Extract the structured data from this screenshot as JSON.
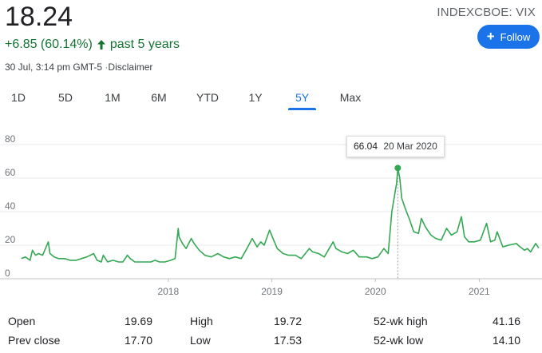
{
  "quote": {
    "price": "18.24",
    "ticker": "INDEXCBOE: VIX",
    "change": "+6.85 (60.14%)",
    "period": "past 5 years",
    "timestamp": "30 Jul, 3:14 pm GMT-5",
    "separator": "·",
    "disclaimer": "Disclaimer",
    "change_color": "#137333"
  },
  "follow_button": {
    "label": "Follow",
    "icon": "plus-icon"
  },
  "tabs": [
    {
      "label": "1D"
    },
    {
      "label": "5D"
    },
    {
      "label": "1M"
    },
    {
      "label": "6M"
    },
    {
      "label": "YTD"
    },
    {
      "label": "1Y"
    },
    {
      "label": "5Y",
      "active": true
    },
    {
      "label": "Max"
    }
  ],
  "tooltip": {
    "value": "66.04",
    "date": "20 Mar 2020"
  },
  "stats": [
    {
      "label": "Open",
      "value": "19.69"
    },
    {
      "label": "High",
      "value": "19.72"
    },
    {
      "label": "52-wk high",
      "value": "41.16"
    },
    {
      "label": "Prev close",
      "value": "17.70"
    },
    {
      "label": "Low",
      "value": "17.53"
    },
    {
      "label": "52-wk low",
      "value": "14.10"
    }
  ],
  "chart_data": {
    "type": "line",
    "color": "#34a853",
    "ylim": [
      0,
      80
    ],
    "yticks": [
      "0",
      "20",
      "40",
      "60",
      "80"
    ],
    "xticks": [
      "2018",
      "2019",
      "2020",
      "2021"
    ],
    "x": [
      "2016-08-01",
      "2016-08-15",
      "2016-09-01",
      "2016-09-09",
      "2016-09-20",
      "2016-10-01",
      "2016-10-15",
      "2016-11-04",
      "2016-11-10",
      "2016-11-25",
      "2016-12-10",
      "2017-01-01",
      "2017-01-20",
      "2017-02-10",
      "2017-03-01",
      "2017-03-20",
      "2017-04-13",
      "2017-04-25",
      "2017-05-10",
      "2017-05-17",
      "2017-06-01",
      "2017-06-20",
      "2017-07-10",
      "2017-07-25",
      "2017-08-10",
      "2017-08-20",
      "2017-09-05",
      "2017-09-25",
      "2017-10-15",
      "2017-11-01",
      "2017-11-15",
      "2017-12-01",
      "2017-12-20",
      "2018-01-10",
      "2018-01-25",
      "2018-02-05",
      "2018-02-08",
      "2018-02-20",
      "2018-03-05",
      "2018-03-23",
      "2018-04-02",
      "2018-04-20",
      "2018-05-10",
      "2018-06-01",
      "2018-06-25",
      "2018-07-15",
      "2018-08-05",
      "2018-08-25",
      "2018-09-15",
      "2018-10-05",
      "2018-10-24",
      "2018-11-10",
      "2018-11-23",
      "2018-12-05",
      "2018-12-24",
      "2019-01-05",
      "2019-01-20",
      "2019-02-10",
      "2019-03-01",
      "2019-03-25",
      "2019-04-15",
      "2019-05-13",
      "2019-05-25",
      "2019-06-15",
      "2019-07-05",
      "2019-08-05",
      "2019-08-15",
      "2019-09-05",
      "2019-09-25",
      "2019-10-15",
      "2019-11-05",
      "2019-12-01",
      "2019-12-20",
      "2020-01-10",
      "2020-01-31",
      "2020-02-15",
      "2020-02-28",
      "2020-03-09",
      "2020-03-16",
      "2020-03-20",
      "2020-03-27",
      "2020-04-03",
      "2020-04-15",
      "2020-05-01",
      "2020-05-15",
      "2020-06-01",
      "2020-06-11",
      "2020-06-25",
      "2020-07-15",
      "2020-08-01",
      "2020-08-20",
      "2020-09-08",
      "2020-09-25",
      "2020-10-15",
      "2020-10-30",
      "2020-11-10",
      "2020-11-25",
      "2020-12-15",
      "2021-01-05",
      "2021-01-27",
      "2021-02-10",
      "2021-02-25",
      "2021-03-05",
      "2021-03-25",
      "2021-04-15",
      "2021-05-12",
      "2021-05-25",
      "2021-06-10",
      "2021-06-20",
      "2021-07-01",
      "2021-07-19",
      "2021-07-30"
    ],
    "values": [
      12,
      13,
      11,
      17,
      14,
      15,
      14,
      22,
      15,
      13,
      12,
      12,
      11,
      11,
      12,
      13,
      15,
      11,
      10,
      14,
      10,
      11,
      10,
      10,
      14,
      12,
      10,
      10,
      10,
      10,
      11,
      10,
      10,
      11,
      12,
      30,
      25,
      21,
      18,
      24,
      21,
      17,
      14,
      13,
      15,
      13,
      12,
      13,
      12,
      18,
      24,
      19,
      22,
      20,
      29,
      24,
      18,
      15,
      14,
      14,
      12,
      18,
      16,
      15,
      13,
      22,
      18,
      16,
      15,
      17,
      13,
      13,
      12,
      13,
      18,
      15,
      40,
      50,
      57,
      66.04,
      60,
      48,
      42,
      35,
      28,
      27,
      36,
      31,
      26,
      24,
      23,
      30,
      26,
      28,
      37,
      25,
      22,
      22,
      23,
      33,
      22,
      23,
      28,
      19,
      20,
      21,
      19,
      17,
      18,
      16,
      21,
      18.24
    ],
    "grid": true,
    "peak": {
      "x": "2020-03-20",
      "y": 66.04
    }
  }
}
